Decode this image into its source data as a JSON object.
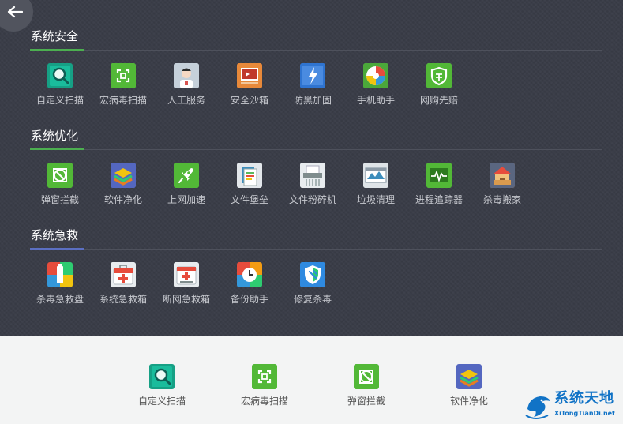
{
  "colors": {
    "panel_bg": "#3a3d48",
    "bottom_bg": "#f3f4f4",
    "accent_security": "#4caf50",
    "accent_optimize": "#4caf50",
    "accent_rescue": "#5b6fc2",
    "watermark": "#1173c6"
  },
  "header": {
    "back_icon": "back-arrow-icon"
  },
  "sections": [
    {
      "title": "系统安全",
      "tools": [
        {
          "label": "自定义扫描",
          "icon": "magnifier-icon"
        },
        {
          "label": "宏病毒扫描",
          "icon": "macro-scan-icon"
        },
        {
          "label": "人工服务",
          "icon": "support-agent-icon"
        },
        {
          "label": "安全沙箱",
          "icon": "sandbox-icon"
        },
        {
          "label": "防黑加固",
          "icon": "hacker-defense-icon"
        },
        {
          "label": "手机助手",
          "icon": "phone-assistant-icon"
        },
        {
          "label": "网购先赔",
          "icon": "shopping-shield-icon"
        }
      ]
    },
    {
      "title": "系统优化",
      "tools": [
        {
          "label": "弹窗拦截",
          "icon": "popup-block-icon"
        },
        {
          "label": "软件净化",
          "icon": "software-clean-icon"
        },
        {
          "label": "上网加速",
          "icon": "rocket-icon"
        },
        {
          "label": "文件堡垒",
          "icon": "file-fortress-icon"
        },
        {
          "label": "文件粉碎机",
          "icon": "shredder-icon"
        },
        {
          "label": "垃圾清理",
          "icon": "junk-clean-icon"
        },
        {
          "label": "进程追踪器",
          "icon": "process-tracker-icon"
        },
        {
          "label": "杀毒搬家",
          "icon": "move-house-icon"
        }
      ]
    },
    {
      "title": "系统急救",
      "tools": [
        {
          "label": "杀毒急救盘",
          "icon": "rescue-usb-icon"
        },
        {
          "label": "系统急救箱",
          "icon": "first-aid-kit-icon"
        },
        {
          "label": "断网急救箱",
          "icon": "network-aid-icon"
        },
        {
          "label": "备份助手",
          "icon": "backup-clock-icon"
        },
        {
          "label": "修复杀毒",
          "icon": "repair-shield-icon"
        }
      ]
    }
  ],
  "bottom_tools": [
    {
      "label": "自定义扫描",
      "icon": "magnifier-icon"
    },
    {
      "label": "宏病毒扫描",
      "icon": "macro-scan-icon"
    },
    {
      "label": "弹窗拦截",
      "icon": "popup-block-icon"
    },
    {
      "label": "软件净化",
      "icon": "software-clean-icon"
    }
  ],
  "watermark": {
    "title": "系统天地",
    "url": "XiTongTianDi.net",
    "icon": "dolphin-logo-icon"
  }
}
